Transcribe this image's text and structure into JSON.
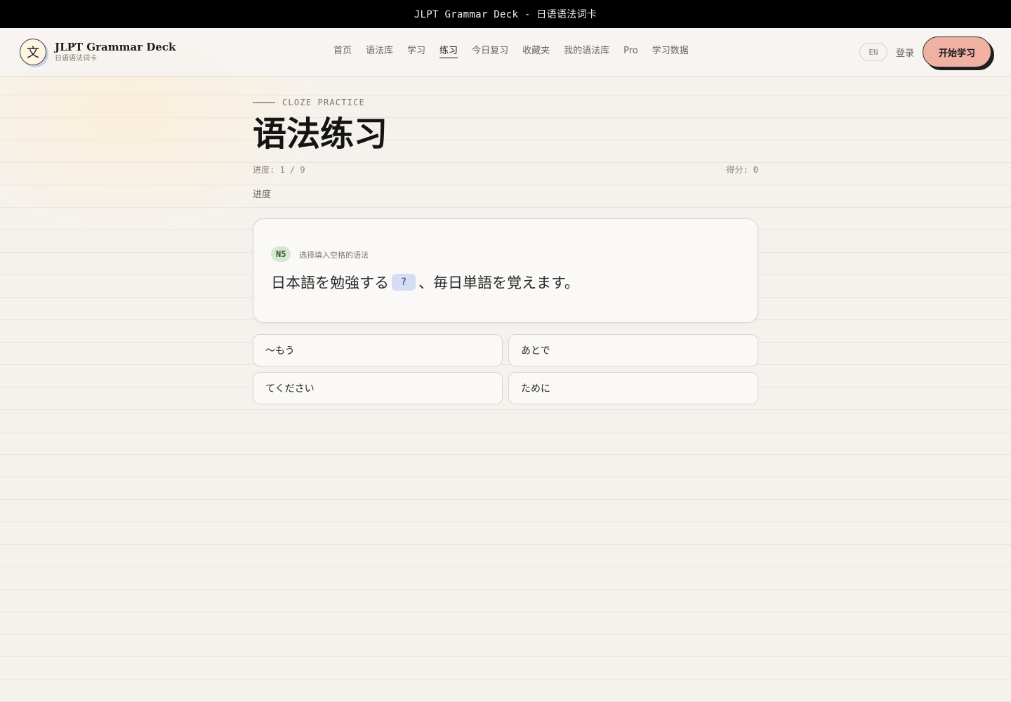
{
  "window": {
    "title": "JLPT Grammar Deck - 日语语法词卡"
  },
  "brand": {
    "logo_char": "文",
    "title": "JLPT Grammar Deck",
    "subtitle": "日语语法词卡"
  },
  "nav": {
    "items": [
      {
        "label": "首页",
        "active": false
      },
      {
        "label": "语法库",
        "active": false
      },
      {
        "label": "学习",
        "active": false
      },
      {
        "label": "练习",
        "active": true
      },
      {
        "label": "今日复习",
        "active": false
      },
      {
        "label": "收藏夹",
        "active": false
      },
      {
        "label": "我的语法库",
        "active": false
      },
      {
        "label": "Pro",
        "active": false
      },
      {
        "label": "学习数据",
        "active": false
      }
    ],
    "lang": "EN",
    "login": "登录",
    "start": "开始学习"
  },
  "page": {
    "eyebrow": "CLOZE PRACTICE",
    "title": "语法练习",
    "progress": "进度: 1 / 9",
    "progress_value": {
      "current": 1,
      "total": 9
    },
    "score": "得分: 0",
    "progress_label": "进度"
  },
  "question": {
    "level": "N5",
    "instruction": "选择填入空格的语法",
    "before": "日本語を勉強する",
    "blank": "?",
    "after": "、毎日単語を覚えます。"
  },
  "options": [
    "～もう",
    "あとで",
    "てください",
    "ために"
  ],
  "colors": {
    "accent_button": "#f0b1a3",
    "level_badge_bg": "#d6e8d2",
    "blank_bg": "#d4ddf4",
    "titlebar_bg": "#000000",
    "page_bg": "#f5f2ee"
  }
}
